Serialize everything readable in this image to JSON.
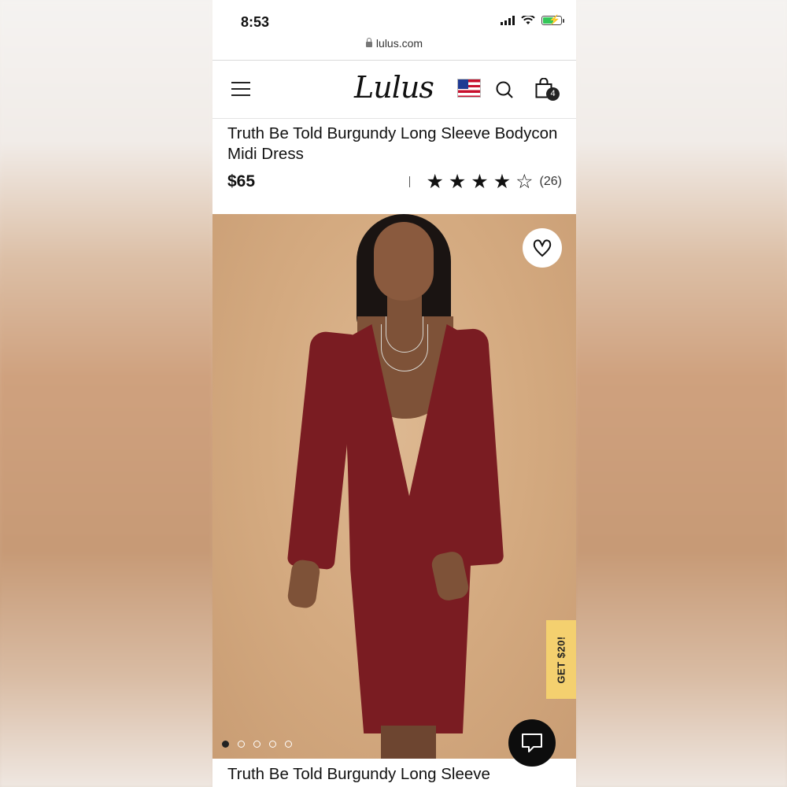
{
  "status_bar": {
    "time": "8:53"
  },
  "browser": {
    "url": "lulus.com"
  },
  "nav": {
    "logo": "Lulus",
    "cart_count": "4",
    "icons": [
      "menu-icon",
      "flag-icon",
      "search-icon",
      "shopping-bag-icon"
    ]
  },
  "product": {
    "title": "Truth Be Told Burgundy Long Sleeve Bodycon Midi Dress",
    "price": "$65",
    "rating_value": 4.5,
    "review_count": "(26)",
    "title_repeat": "Truth Be Told Burgundy Long Sleeve"
  },
  "gallery": {
    "image_count": 5,
    "active_index": 0
  },
  "promo": {
    "label": "GET $20!"
  },
  "colors": {
    "dress": "#7a1c22",
    "promo": "#f4d06f",
    "background": "#d4aa80"
  }
}
